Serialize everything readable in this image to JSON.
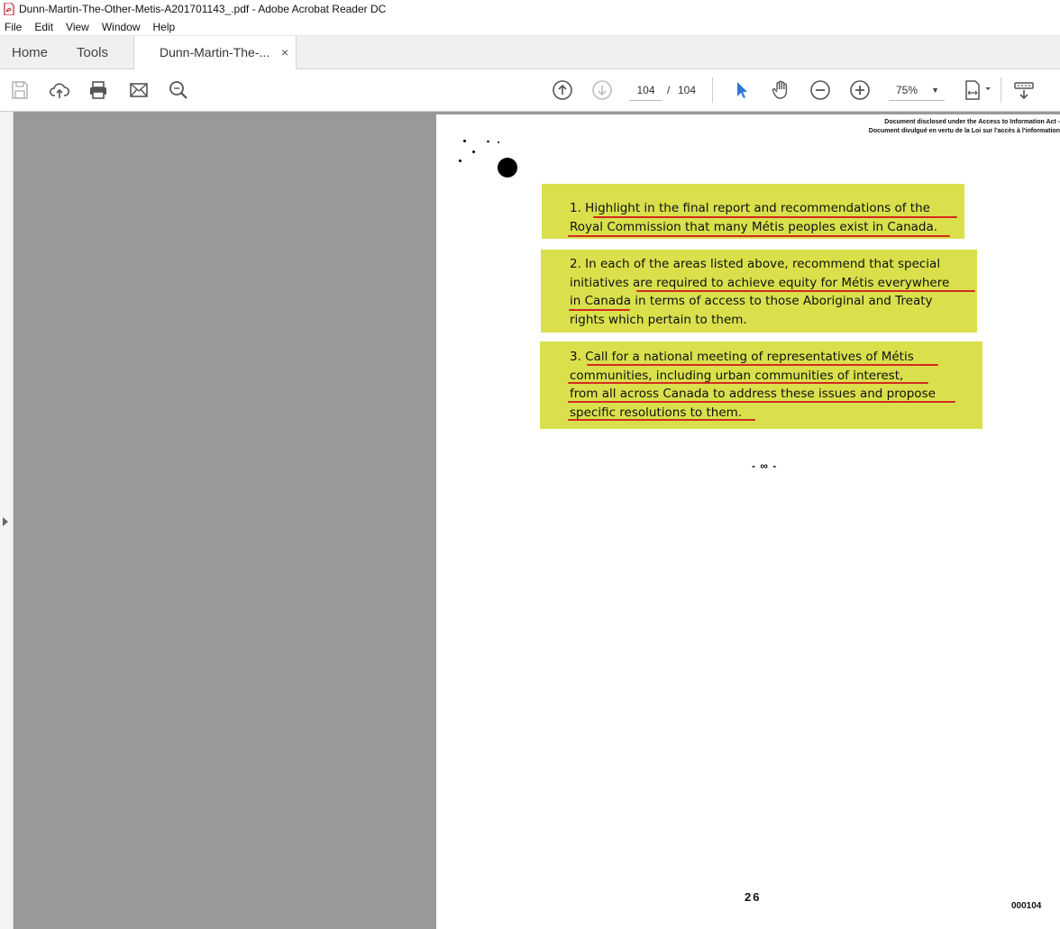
{
  "window": {
    "title": "Dunn-Martin-The-Other-Metis-A201701143_.pdf - Adobe Acrobat Reader DC"
  },
  "menu": [
    "File",
    "Edit",
    "View",
    "Window",
    "Help"
  ],
  "tabs": {
    "home": "Home",
    "tools": "Tools",
    "document": "Dunn-Martin-The-...",
    "close": "×"
  },
  "toolbar": {
    "current_page": "104",
    "separator": "/",
    "total_pages": "104",
    "zoom": "75%"
  },
  "document": {
    "disclaimer_line1": "Document disclosed under the Access to Information Act -",
    "disclaimer_line2": "Document divulgué en vertu de la Loi sur l'accès à l'information",
    "recommendations": [
      {
        "lines": [
          "1.  Highlight in the final report and recommendations of the",
          "Royal Commission that many Métis peoples exist in Canada."
        ]
      },
      {
        "lines": [
          "2. In each of the areas listed above, recommend that special",
          "initiatives are required to achieve equity for Métis everywhere",
          "in Canada in terms of access to those Aboriginal and Treaty",
          "rights which pertain to them."
        ]
      },
      {
        "lines": [
          "3. Call for a national meeting of representatives of Métis",
          "communities, including urban communities of interest,",
          "from all across Canada to address these issues and propose",
          "specific resolutions to them."
        ]
      }
    ],
    "divider": "- ∞ -",
    "page_number": "26",
    "doc_number": "000104"
  },
  "colors": {
    "highlight": "#d9e04c",
    "underline": "#d42a20",
    "canvas": "#999999"
  }
}
